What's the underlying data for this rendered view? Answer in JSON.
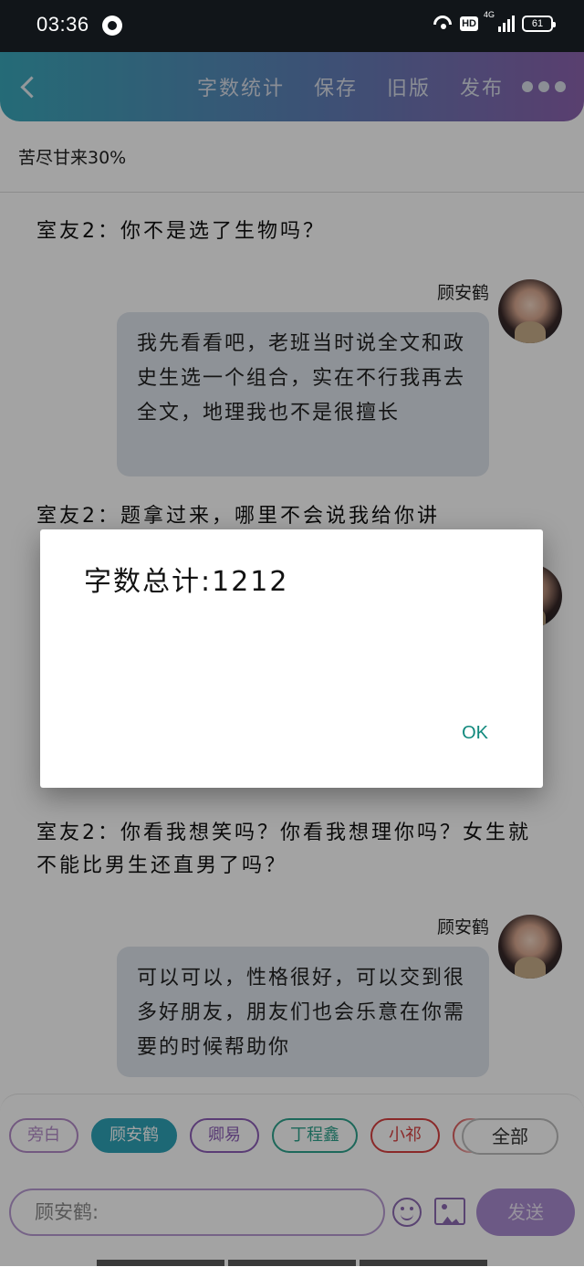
{
  "status_bar": {
    "time": "03:36",
    "network_badge": "HD",
    "network_type": "4G",
    "battery": "61"
  },
  "toolbar": {
    "back_icon": "chevron-left-icon",
    "actions": [
      "字数统计",
      "保存",
      "旧版",
      "发布"
    ],
    "more_icon": "more-dots-icon"
  },
  "document": {
    "subtitle": "苦尽甘来30%"
  },
  "chat": {
    "messages": [
      {
        "text": "室友2：你不是选了生物吗？"
      },
      {
        "sender": "顾安鹤",
        "text": "我先看看吧，老班当时说全文和政史生选一个组合，实在不行我再去全文，地理我也不是很擅长"
      },
      {
        "text": "室友2：题拿过来，哪里不会说我给你讲"
      },
      {
        "text": "室友2：你看我想笑吗？你看我想理你吗？女生就不能比男生还直男了吗？"
      },
      {
        "sender": "顾安鹤",
        "text": "可以可以，性格很好，可以交到很多好朋友，朋友们也会乐意在你需要的时候帮助你"
      }
    ]
  },
  "bottom": {
    "chips": [
      {
        "label": "旁白",
        "color": "#b48cc9",
        "selected": false
      },
      {
        "label": "顾安鹤",
        "color": "#2ea3b8",
        "selected": true
      },
      {
        "label": "卿易",
        "color": "#8e5fb8",
        "selected": false
      },
      {
        "label": "丁程鑫",
        "color": "#2ea38e",
        "selected": false
      },
      {
        "label": "小祁",
        "color": "#d84040",
        "selected": false
      },
      {
        "label": "",
        "color": "#d84040",
        "selected": false
      }
    ],
    "all_chip": "全部",
    "input_value": "顾安鹤:",
    "send_label": "发送"
  },
  "dialog": {
    "message": "字数总计:1212",
    "ok_label": "OK"
  }
}
